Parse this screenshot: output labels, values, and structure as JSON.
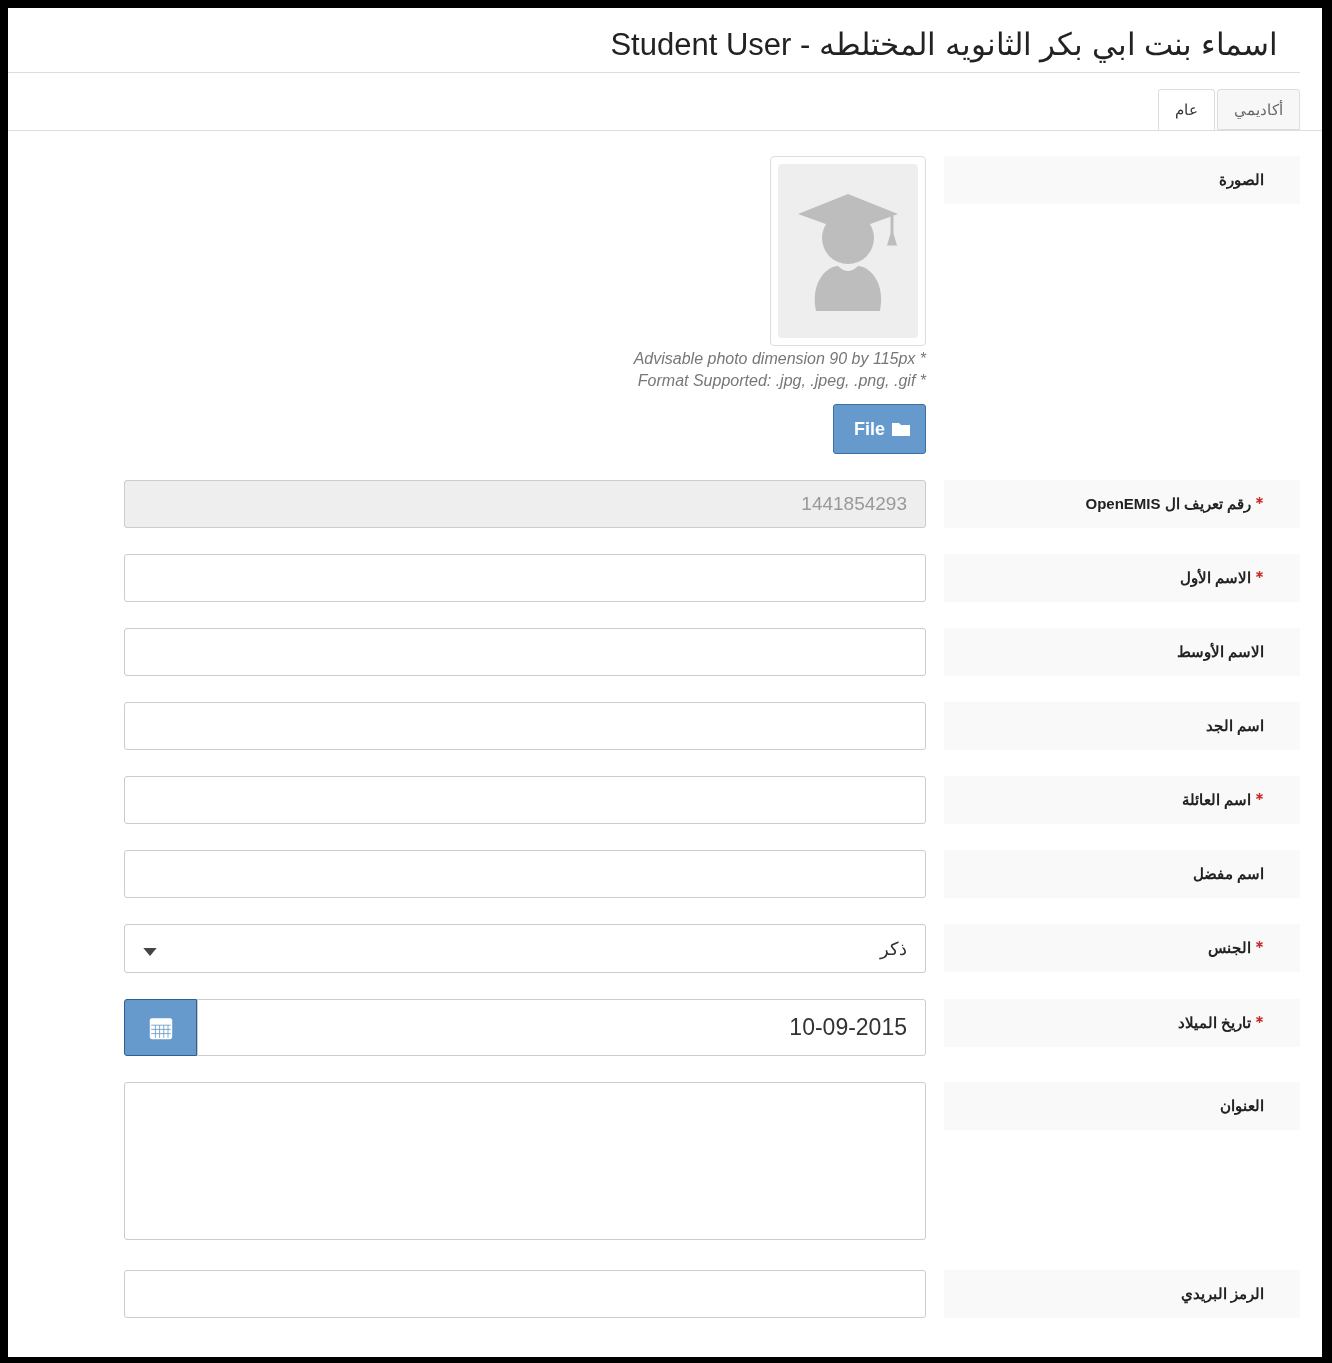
{
  "page_title": "اسماء بنت ابي بكر الثانويه المختلطه - Student User",
  "tabs": [
    {
      "label": "أكاديمي",
      "selected": false
    },
    {
      "label": "عام",
      "selected": true
    }
  ],
  "fields": [
    {
      "kind": "photo",
      "label": "الصورة",
      "required": false,
      "hints": [
        "Advisable photo dimension 90 by 115px *",
        "Format Supported: .jpg, .jpeg, .png, .gif *"
      ],
      "button": "File"
    },
    {
      "kind": "text",
      "label": "رقم تعريف ال OpenEMIS",
      "required": true,
      "value": "1441854293",
      "disabled": true
    },
    {
      "kind": "text",
      "label": "الاسم الأول",
      "required": true,
      "disabled": false
    },
    {
      "kind": "text",
      "label": "الاسم الأوسط",
      "required": false,
      "disabled": false
    },
    {
      "kind": "text",
      "label": "اسم الجد",
      "required": false,
      "disabled": false
    },
    {
      "kind": "text",
      "label": "اسم العائلة",
      "required": true,
      "disabled": false
    },
    {
      "kind": "text",
      "label": "اسم مفضل",
      "required": false,
      "disabled": false
    },
    {
      "kind": "select",
      "label": "الجنس",
      "required": true,
      "value": "ذكر"
    },
    {
      "kind": "date",
      "label": "تاريخ الميلاد",
      "required": true,
      "value": "10-09-2015"
    },
    {
      "kind": "textarea",
      "label": "العنوان",
      "required": false
    },
    {
      "kind": "text",
      "label": "الرمز البريدي",
      "required": false,
      "disabled": false
    }
  ]
}
